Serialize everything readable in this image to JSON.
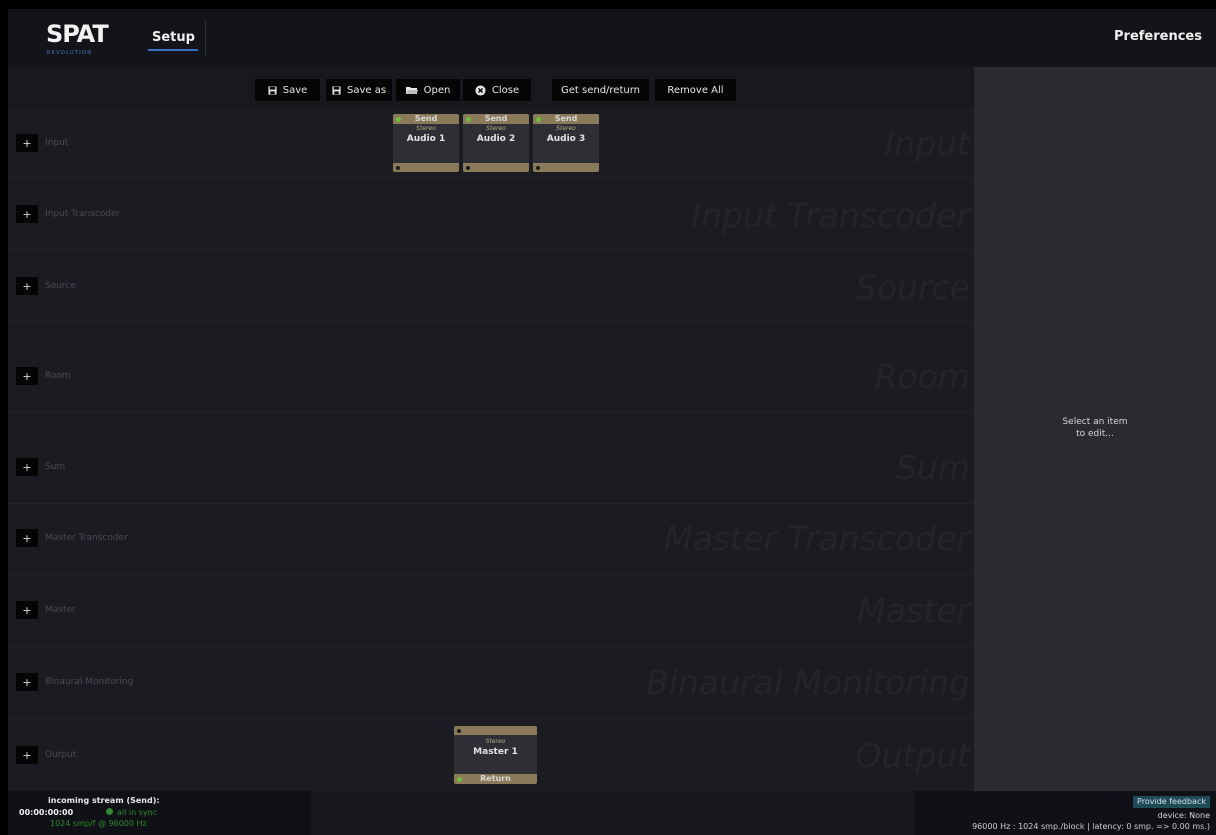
{
  "header": {
    "logo_text": "SPAT",
    "logo_subtext": "REVOLUTION",
    "tab_label": "Setup",
    "preferences_label": "Preferences"
  },
  "toolbar": {
    "save_label": "Save",
    "save_as_label": "Save as",
    "open_label": "Open",
    "close_label": "Close",
    "get_send_return_label": "Get send/return",
    "remove_all_label": "Remove All"
  },
  "lanes": [
    {
      "add": "+",
      "label": "Input",
      "watermark": "Input"
    },
    {
      "add": "+",
      "label": "Input Transcoder",
      "watermark": "Input Transcoder"
    },
    {
      "add": "+",
      "label": "Source",
      "watermark": "Source"
    },
    {
      "add": "+",
      "label": "Room",
      "watermark": "Room"
    },
    {
      "add": "+",
      "label": "Sum",
      "watermark": "Sum"
    },
    {
      "add": "+",
      "label": "Master Transcoder",
      "watermark": "Master Transcoder"
    },
    {
      "add": "+",
      "label": "Master",
      "watermark": "Master"
    },
    {
      "add": "+",
      "label": "Binaural Monitoring",
      "watermark": "Binaural Monitoring"
    },
    {
      "add": "+",
      "label": "Output",
      "watermark": "Output"
    }
  ],
  "input_nodes": [
    {
      "tag": "Send",
      "type": "Stereo",
      "name": "Audio 1"
    },
    {
      "tag": "Send",
      "type": "Stereo",
      "name": "Audio 2"
    },
    {
      "tag": "Send",
      "type": "Stereo",
      "name": "Audio 3"
    }
  ],
  "output_node": {
    "type": "Stereo",
    "name": "Master 1",
    "tag": "Return"
  },
  "right_panel": {
    "hint_line1": "Select an item",
    "hint_line2": "to edit..."
  },
  "status": {
    "stream_title": "incoming stream (Send):",
    "timecode": "00:00:00:00",
    "sync_text": "all in sync",
    "rate_text": "1024 smp/f @ 96000 Hz",
    "feedback_label": "Provide feedback",
    "device_text": "device: None",
    "latency_text": "96000 Hz : 1024 smp./block | latency: 0 smp. => 0.00 ms.)"
  },
  "colors": {
    "accent_blue": "#3b6fc4",
    "node_header": "#8a7a5a",
    "sync_green": "#2e8a2e",
    "feedback_bg": "#1f4b56"
  },
  "icons": {
    "save": "floppy-disk-icon",
    "save_as": "floppy-disk-icon",
    "open": "folder-open-icon",
    "close": "close-circle-icon"
  }
}
